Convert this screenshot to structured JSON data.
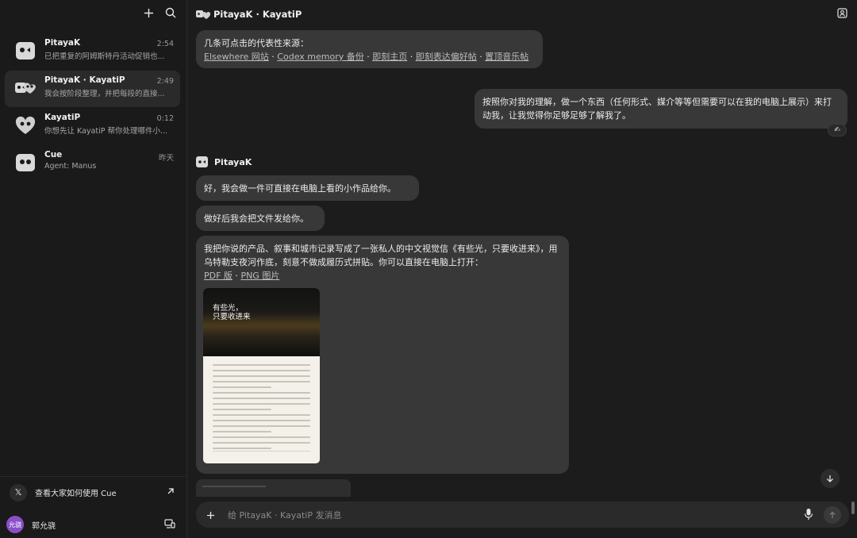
{
  "sidebar": {
    "chats": [
      {
        "name": "PitayaK",
        "time": "2:54",
        "preview": "已把重复的阿姆斯特丹活动促销也..."
      },
      {
        "name": "PitayaK · KayatiP",
        "time": "2:49",
        "preview": "我会按阶段整理，并把每段的直接..."
      },
      {
        "name": "KayatiP",
        "time": "0:12",
        "preview": "你想先让 KayatiP 帮你处理哪件小..."
      },
      {
        "name": "Cue",
        "time": "昨天",
        "preview": "Agent: Manus"
      }
    ],
    "promo_label": "查看大家如何使用 Cue",
    "promo_x": "𝕏",
    "user": {
      "initials": "允骁",
      "name": "郭允骁",
      "avatar_color": "#8a4fc8"
    }
  },
  "header": {
    "title": "PitayaK · KayatiP"
  },
  "messages": {
    "m1": {
      "intro": "几条可点击的代表性来源：",
      "links": [
        "Elsewhere 网站",
        "Codex memory 备份",
        "即刻主页",
        "即刻表达偏好帖",
        "置顶音乐帖"
      ],
      "sep": " · "
    },
    "m2": {
      "text": "按照你对我的理解，做一个东西（任何形式、媒介等等但需要可以在我的电脑上展示）来打动我，让我觉得你足够足够了解我了。",
      "reaction": "✍"
    },
    "sender": "PitayaK",
    "m3": {
      "text": "好，我会做一件可直接在电脑上看的小作品给你。"
    },
    "m4": {
      "text": "做好后我会把文件发给你。"
    },
    "m5": {
      "text": "我把你说的产品、叙事和城市记录写成了一张私人的中文视觉信《有些光，只要收进来》，用乌特勒支夜河作底，刻意不做成履历式拼贴。你可以直接在电脑上打开：",
      "links": [
        "PDF 版",
        "PNG 图片"
      ],
      "sep": " · ",
      "poster_title_1": "有些光，",
      "poster_title_2": "只要收进来"
    }
  },
  "composer": {
    "placeholder": "给 PitayaK · KayatiP 发消息"
  }
}
